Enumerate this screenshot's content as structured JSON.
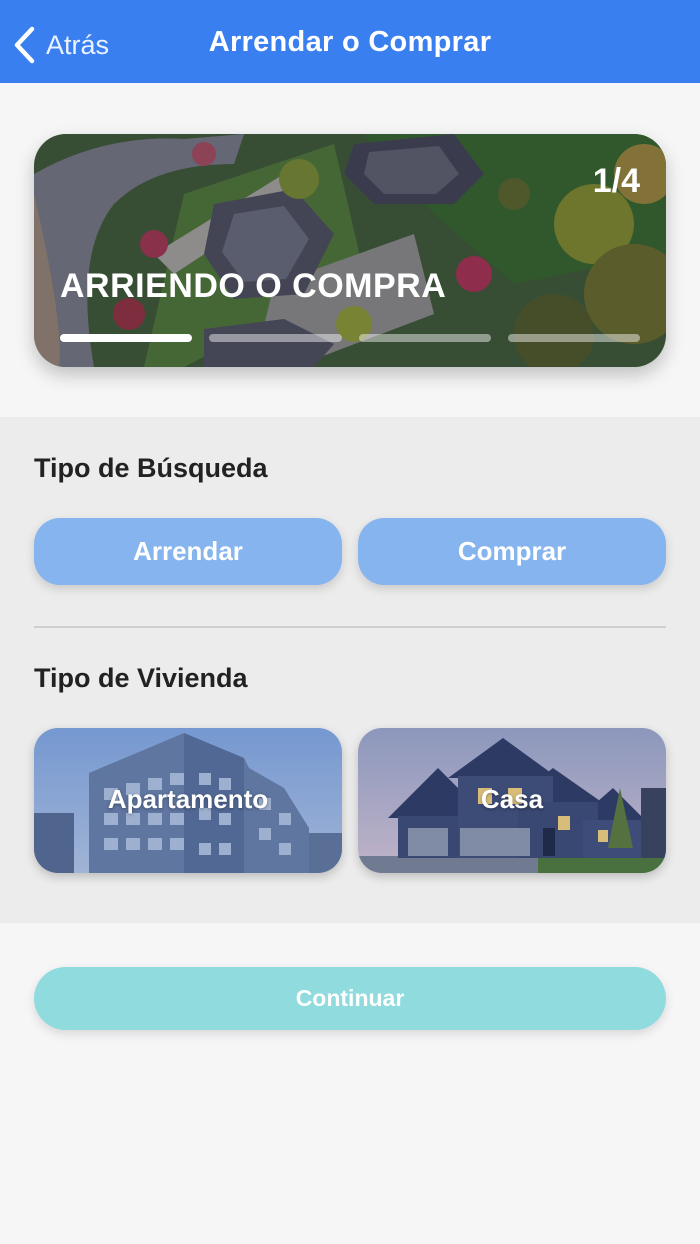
{
  "header": {
    "back_label": "Atrás",
    "title": "Arrendar o Comprar"
  },
  "hero": {
    "step": "1/4",
    "title": "ARRIENDO O COMPRA",
    "progress_segments": [
      1,
      0,
      0,
      0
    ]
  },
  "search_type": {
    "label": "Tipo de Búsqueda",
    "options": [
      "Arrendar",
      "Comprar"
    ]
  },
  "housing_type": {
    "label": "Tipo de Vivienda",
    "options": [
      "Apartamento",
      "Casa"
    ]
  },
  "continue_label": "Continuar",
  "colors": {
    "header": "#3a7ff0",
    "choice_button": "#85b4ee",
    "continue_button": "#8fdbdd",
    "background": "#f6f6f7",
    "panel": "#ececec"
  }
}
